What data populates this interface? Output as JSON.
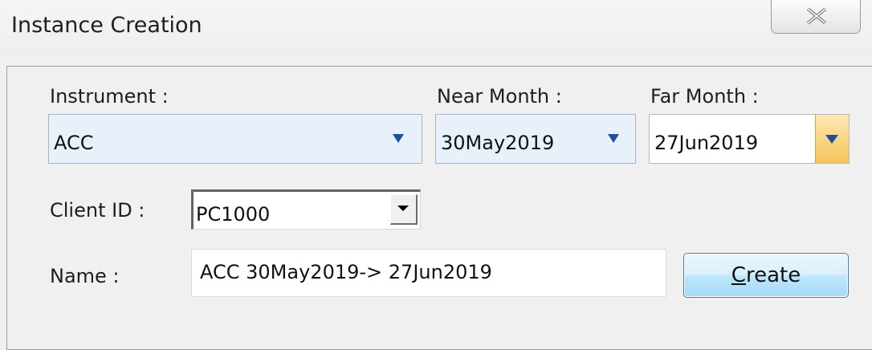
{
  "window": {
    "title": "Instance Creation",
    "close_icon": "close-x-icon"
  },
  "instrument": {
    "label": "Instrument :",
    "value": "ACC"
  },
  "near_month": {
    "label": "Near Month :",
    "value": "30May2019"
  },
  "far_month": {
    "label": "Far Month :",
    "value": "27Jun2019"
  },
  "client": {
    "label": "Client ID :",
    "value": "PC1000"
  },
  "name": {
    "label": "Name :",
    "value": "ACC 30May2019-> 27Jun2019"
  },
  "create_button": {
    "label_underlined": "C",
    "label_rest": "reate"
  },
  "colors": {
    "dropdown_arrow": "#1f4f9a",
    "combo_bg": "#e8f0fa",
    "accent_orange": "#f6c35a",
    "button_border": "#3c7fb1"
  }
}
